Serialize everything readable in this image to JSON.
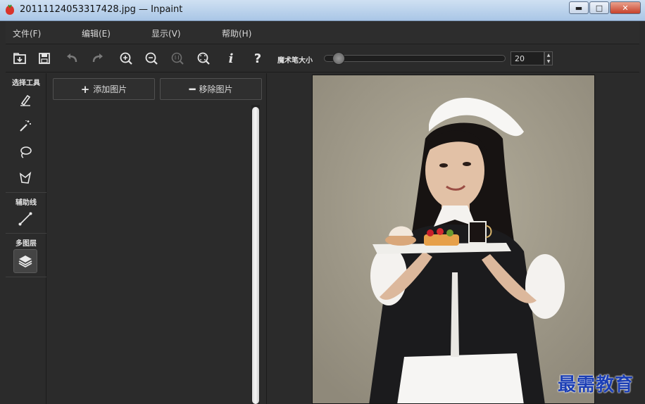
{
  "window": {
    "title": "20111124053317428.jpg — Inpaint",
    "minimize_glyph": "▬",
    "maximize_glyph": "□",
    "close_glyph": "✕"
  },
  "menu": {
    "items": [
      {
        "label": "文件(F)"
      },
      {
        "label": "编辑(E)"
      },
      {
        "label": "显示(V)"
      },
      {
        "label": "帮助(H)"
      }
    ]
  },
  "toolbar": {
    "icons": [
      "open-icon",
      "save-icon",
      "undo-icon",
      "redo-icon",
      "zoom-in-icon",
      "zoom-out-icon",
      "actual-size-icon",
      "fit-icon",
      "info-icon",
      "help-icon"
    ],
    "info_glyph": "i",
    "help_glyph": "?",
    "brush_size_label": "魔术笔大小",
    "brush_size_value": "20",
    "brush_size_fraction": 0.05
  },
  "tools": {
    "select_header": "选择工具",
    "guide_header": "辅助线",
    "layers_header": "多图层",
    "items": [
      "marker-icon",
      "magic-wand-icon",
      "lasso-icon",
      "polygon-lasso-icon",
      "guide-line-icon",
      "layers-icon"
    ]
  },
  "image_list": {
    "add_label": "添加图片",
    "add_symbol": "+",
    "remove_label": "移除图片",
    "remove_symbol": "━"
  },
  "watermark": "最需教育",
  "colors": {
    "panel_bg": "#2b2b2b",
    "photo_bg": "#a49e8d",
    "watermark": "#1c3fb5"
  }
}
